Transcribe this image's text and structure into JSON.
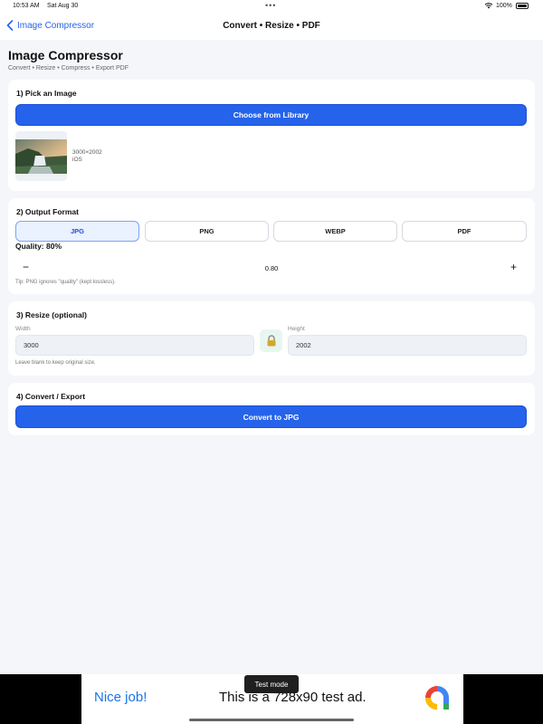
{
  "status_bar": {
    "time": "10:53 AM",
    "date": "Sat Aug 30",
    "battery": "100%"
  },
  "nav": {
    "back_label": "Image Compressor",
    "title": "Convert • Resize • PDF"
  },
  "header": {
    "title": "Image Compressor",
    "subtitle": "Convert • Resize • Compress • Export PDF"
  },
  "pick": {
    "title": "1) Pick an Image",
    "button": "Choose from Library",
    "dimensions": "3000×2002",
    "source": "iOS"
  },
  "format": {
    "title": "2) Output Format",
    "options": [
      "JPG",
      "PNG",
      "WEBP",
      "PDF"
    ],
    "selected": "JPG",
    "quality_label": "Quality: 80%",
    "quality": 0.8,
    "quality_value": "0.80",
    "minus": "−",
    "plus": "+",
    "tip": "Tip: PNG ignores \"quality\" (kept lossless)."
  },
  "resize": {
    "title": "3) Resize (optional)",
    "width_label": "Width",
    "width_value": "3000",
    "height_label": "Height",
    "height_value": "2002",
    "hint": "Leave blank to keep original size."
  },
  "convert": {
    "title": "4) Convert / Export",
    "button": "Convert to JPG"
  },
  "ad": {
    "left": "Nice job!",
    "text": "This is a 728x90 test ad.",
    "badge": "Test mode"
  },
  "colors": {
    "accent": "#2563eb",
    "background": "#f5f6fa"
  }
}
